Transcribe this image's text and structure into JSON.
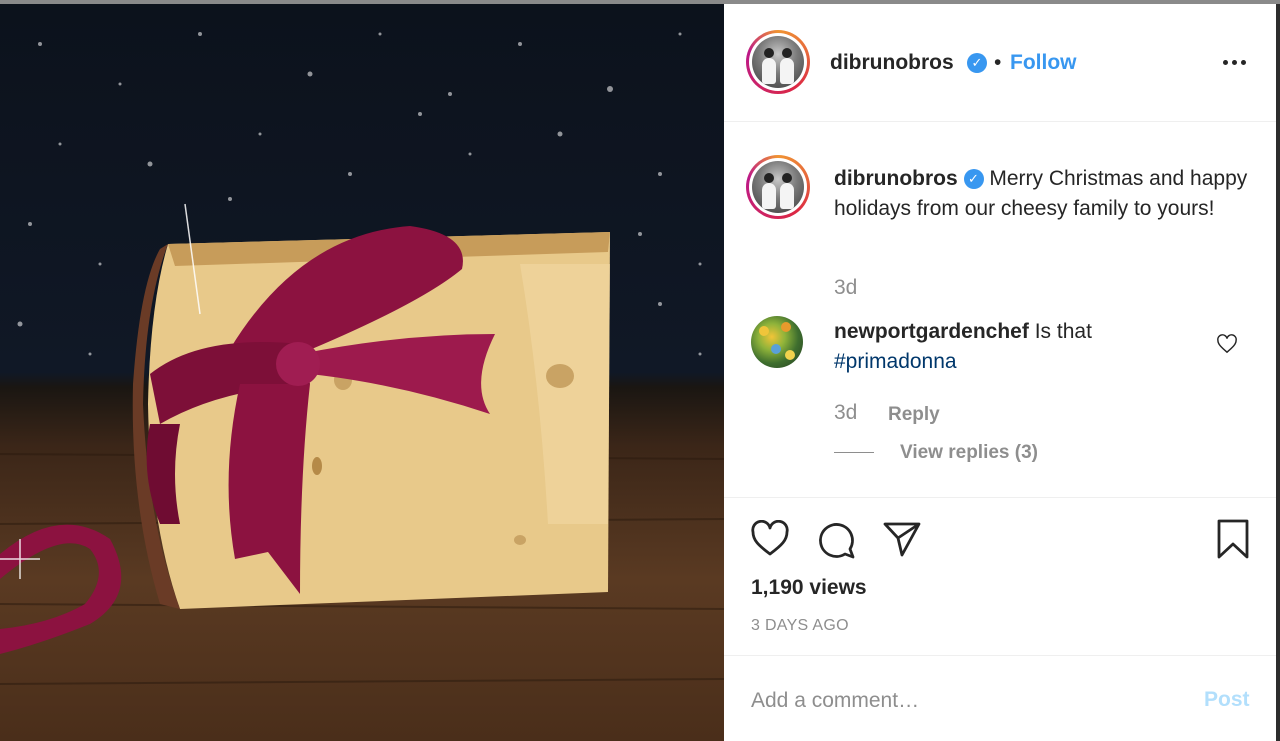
{
  "post": {
    "author": "dibrunobros",
    "follow_label": "Follow",
    "separator": "•",
    "verified_glyph": "✓",
    "caption": {
      "username": "dibrunobros",
      "text": "Merry Christmas and happy holidays from our cheesy family to yours!",
      "timestamp": "3d"
    },
    "comments": [
      {
        "username": "newportgardenchef",
        "text": "Is that ",
        "hashtag": "#primadonna",
        "timestamp": "3d",
        "reply_label": "Reply",
        "view_replies_label": "View replies (3)"
      }
    ],
    "views": "1,190 views",
    "date": "3 DAYS AGO",
    "add_comment_placeholder": "Add a comment…",
    "post_label": "Post"
  },
  "icons": {
    "more": "more-options-icon",
    "like": "heart-icon",
    "comment": "comment-icon",
    "share": "share-icon",
    "save": "bookmark-icon",
    "comment_like": "small-heart-icon"
  },
  "colors": {
    "accent": "#3897f0",
    "post_button_disabled": "#b2dffc",
    "ribbon": "#8c1240",
    "cheese": "#e8c98a"
  }
}
